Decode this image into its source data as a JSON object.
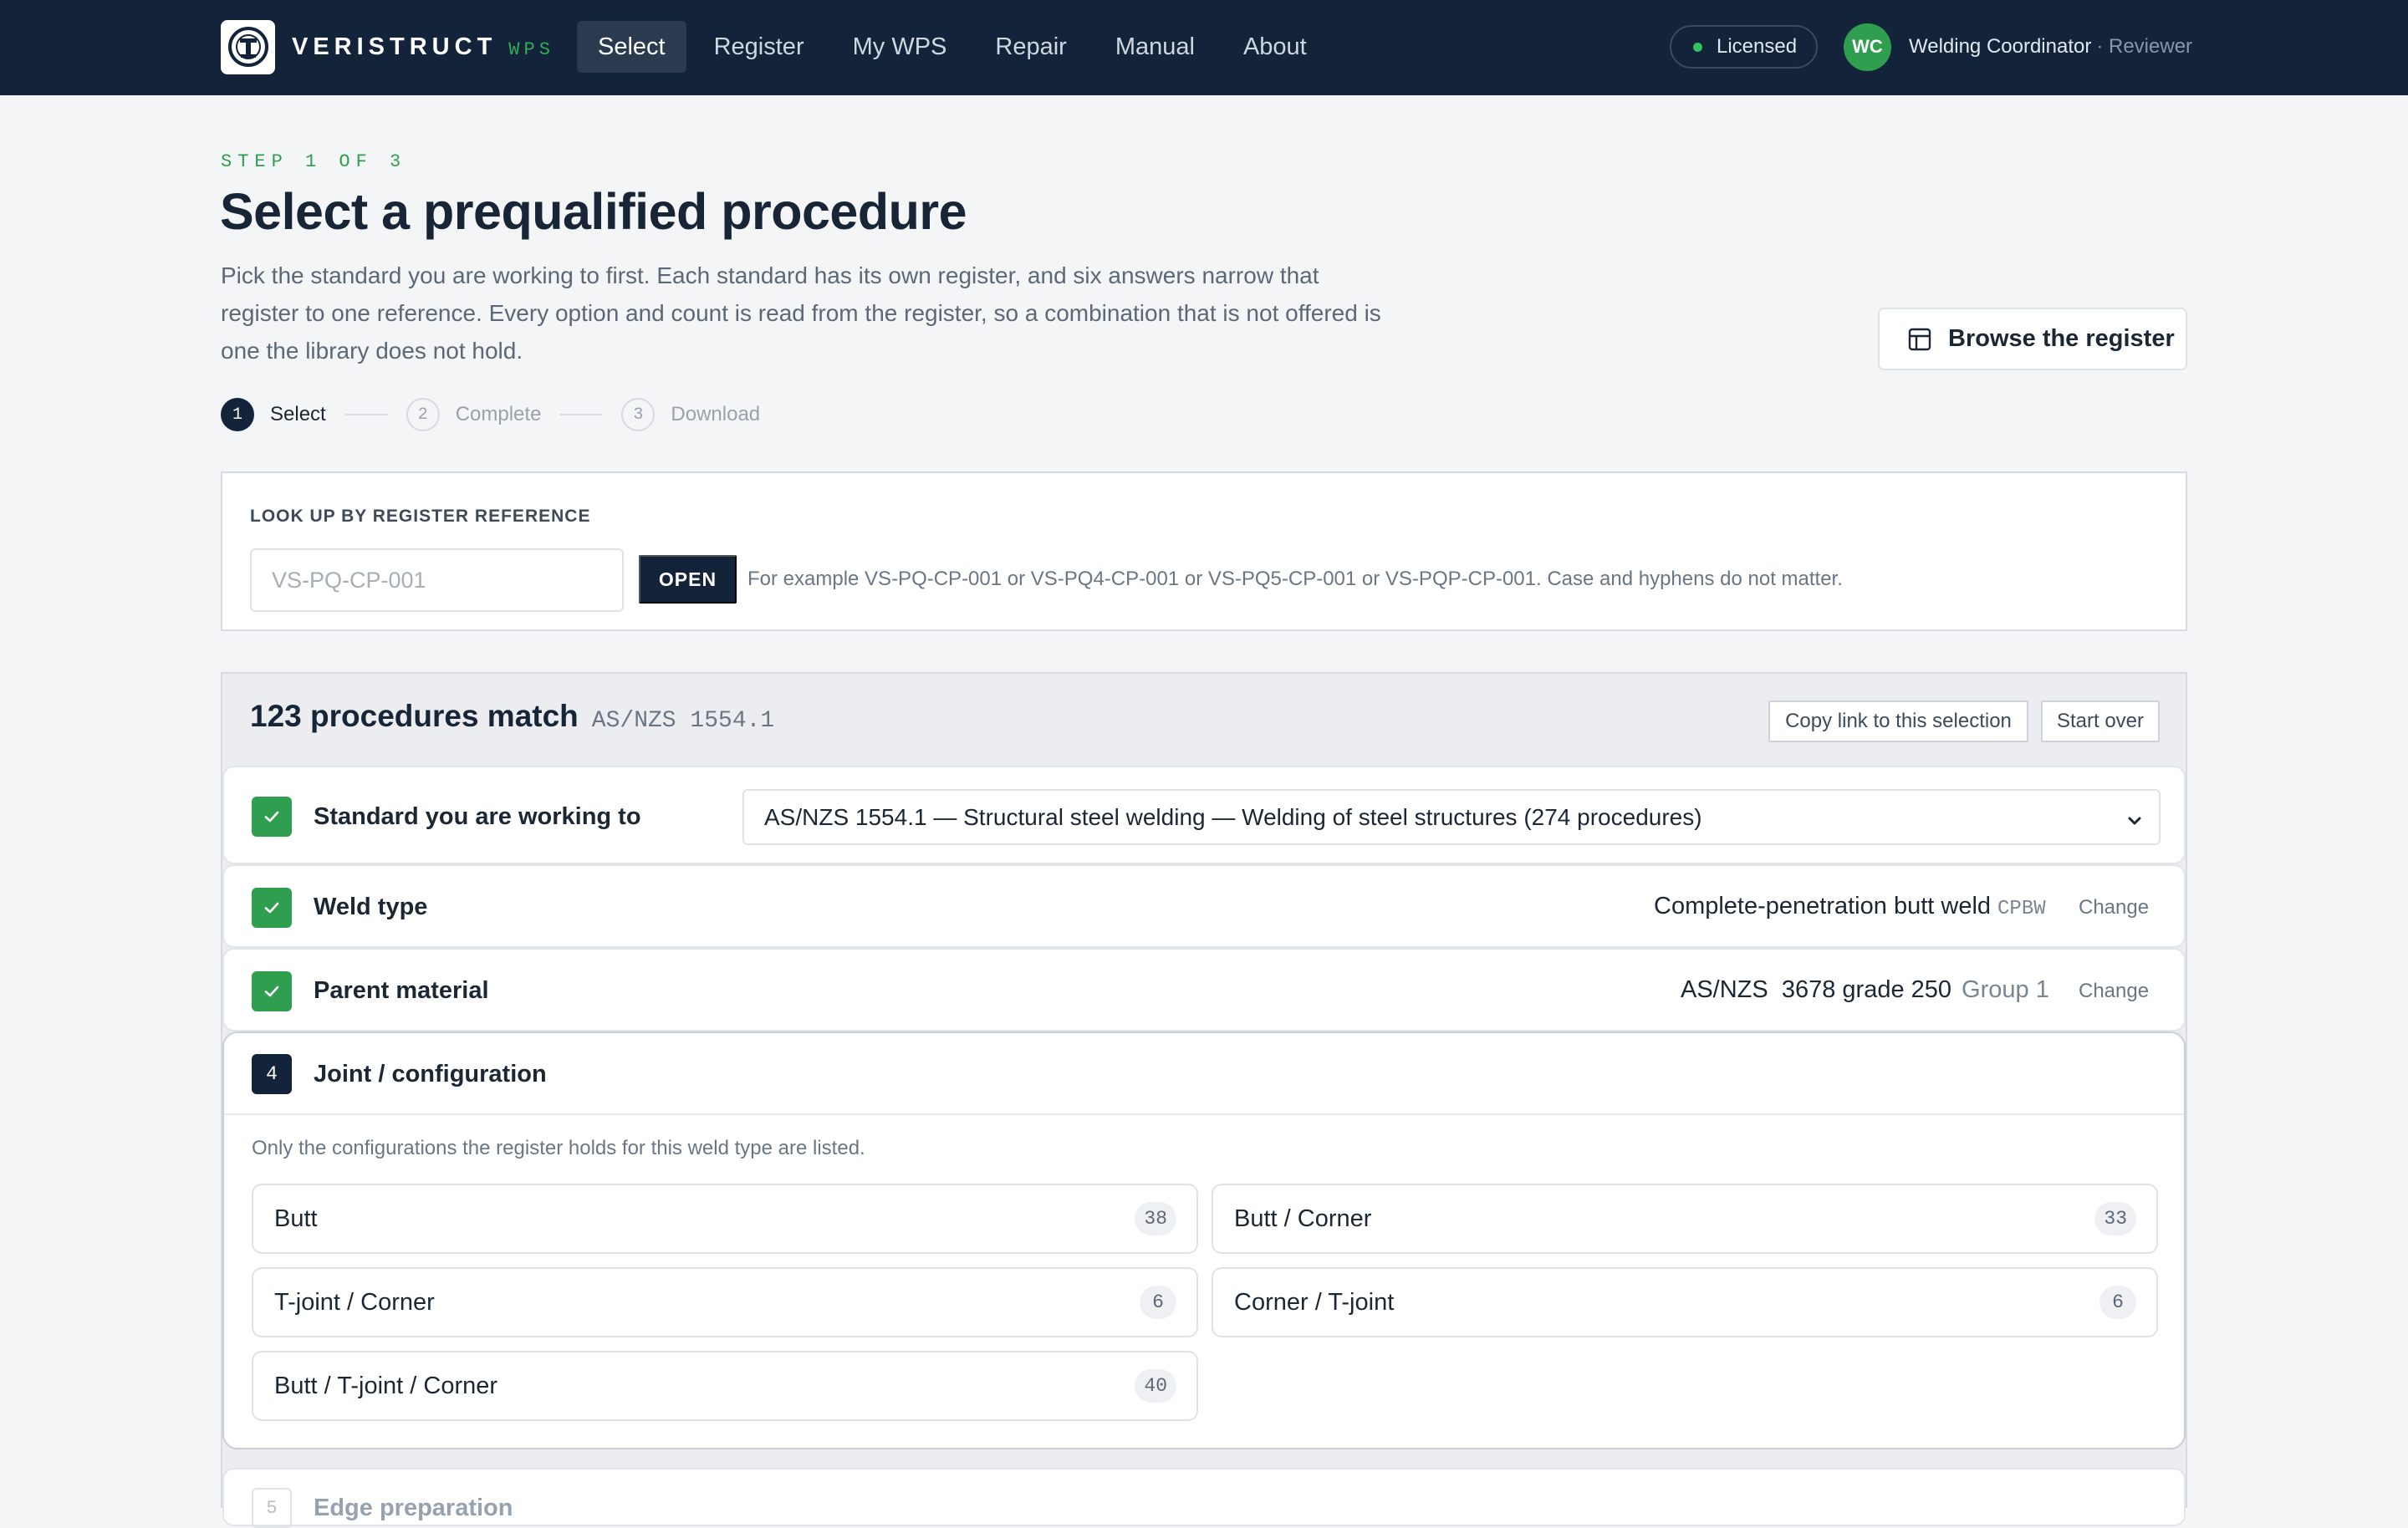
{
  "brand": {
    "name": "VERISTRUCT",
    "sub": "WPS"
  },
  "nav": {
    "items": [
      {
        "label": "Select",
        "active": true
      },
      {
        "label": "Register",
        "active": false
      },
      {
        "label": "My WPS",
        "active": false
      },
      {
        "label": "Repair",
        "active": false
      },
      {
        "label": "Manual",
        "active": false
      },
      {
        "label": "About",
        "active": false
      }
    ]
  },
  "license": {
    "label": "Licensed",
    "color": "#34c160"
  },
  "user": {
    "initials": "WC",
    "name": "Welding Coordinator",
    "role": "· Reviewer"
  },
  "header": {
    "step": "STEP 1 OF 3",
    "title": "Select a prequalified procedure",
    "intro": "Pick the standard you are working to first. Each standard has its own register, and six answers narrow that register to one reference. Every option and count is read from the register, so a combination that is not offered is one the library does not hold.",
    "browse_label": "Browse the register"
  },
  "stepper": [
    {
      "num": "1",
      "label": "Select",
      "state": "active"
    },
    {
      "num": "2",
      "label": "Complete",
      "state": "pending"
    },
    {
      "num": "3",
      "label": "Download",
      "state": "pending"
    }
  ],
  "lookup": {
    "title": "LOOK UP BY REGISTER REFERENCE",
    "placeholder": "VS-PQ-CP-001",
    "value": "",
    "button": "OPEN",
    "hint": "For example VS-PQ-CP-001 or VS-PQ4-CP-001 or VS-PQ5-CP-001 or VS-PQP-CP-001. Case and hyphens do not matter."
  },
  "results": {
    "count_label": "123 procedures match",
    "standard_code": "AS/NZS 1554.1",
    "copy_link": "Copy link to this selection",
    "start_over": "Start over"
  },
  "answers": {
    "standard": {
      "label": "Standard you are working to",
      "selected": "AS/NZS 1554.1 — Structural steel welding — Welding of steel structures (274 procedures)"
    },
    "weld_type": {
      "label": "Weld type",
      "value": "Complete-penetration butt weld",
      "code": "CPBW",
      "change": "Change"
    },
    "parent_material": {
      "label": "Parent material",
      "value": "AS/NZS  3678 grade 250",
      "group": "Group 1",
      "change": "Change"
    },
    "joint": {
      "num": "4",
      "label": "Joint / configuration",
      "note": "Only the configurations the register holds for this weld type are listed.",
      "options": [
        {
          "label": "Butt",
          "count": "38"
        },
        {
          "label": "Butt / Corner",
          "count": "33"
        },
        {
          "label": "T-joint / Corner",
          "count": "6"
        },
        {
          "label": "Corner / T-joint",
          "count": "6"
        },
        {
          "label": "Butt / T-joint / Corner",
          "count": "40"
        }
      ]
    },
    "next": {
      "num": "5",
      "label": "Edge preparation"
    }
  },
  "icons": {
    "check": "check-icon",
    "table": "table-icon",
    "chevron": "chevron-down-icon"
  },
  "colors": {
    "navy": "#13233a",
    "accent_green": "#2f9e4e"
  }
}
